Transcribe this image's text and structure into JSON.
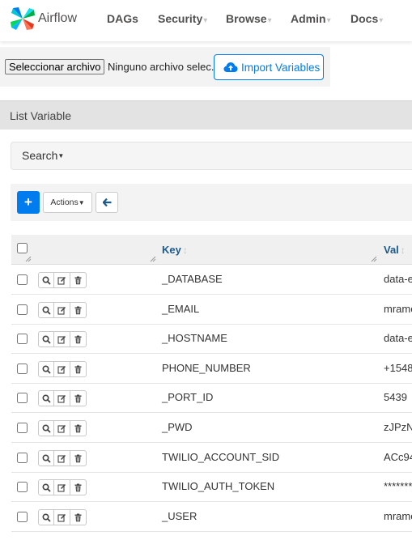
{
  "colors": {
    "primary": "#017cee",
    "header_text": "#1c5a8a",
    "nav_text": "#51504f"
  },
  "navbar": {
    "brand": "Airflow",
    "items": [
      {
        "label": "DAGs",
        "dropdown": false
      },
      {
        "label": "Security",
        "dropdown": true
      },
      {
        "label": "Browse",
        "dropdown": true
      },
      {
        "label": "Admin",
        "dropdown": true
      },
      {
        "label": "Docs",
        "dropdown": true
      }
    ],
    "dropdown_caret": "▾"
  },
  "import": {
    "file_button_label": "Seleccionar archivo",
    "file_status": "Ninguno archivo selec.",
    "import_button_label": "Import Variables",
    "import_icon": "cloud-upload-icon"
  },
  "panel": {
    "title": "List Variable"
  },
  "search": {
    "label": "Search"
  },
  "toolbar": {
    "add_label": "+",
    "actions_label": "Actions",
    "back_icon": "arrow-left-icon"
  },
  "table": {
    "columns": {
      "key": "Key",
      "val": "Val"
    },
    "sort_glyph": "↕",
    "row_actions": [
      "search-icon",
      "edit-icon",
      "trash-icon"
    ],
    "rows": [
      {
        "key": "_DATABASE",
        "val": "data-e"
      },
      {
        "key": "_EMAIL",
        "val": "mramo"
      },
      {
        "key": "_HOSTNAME",
        "val": "data-e"
      },
      {
        "key": "PHONE_NUMBER",
        "val": "+1548"
      },
      {
        "key": "_PORT_ID",
        "val": "5439"
      },
      {
        "key": "_PWD",
        "val": "zJPzN"
      },
      {
        "key": "TWILIO_ACCOUNT_SID",
        "val": "ACc94"
      },
      {
        "key": "TWILIO_AUTH_TOKEN",
        "val": "*******"
      },
      {
        "key": "_USER",
        "val": "mramo"
      }
    ]
  }
}
